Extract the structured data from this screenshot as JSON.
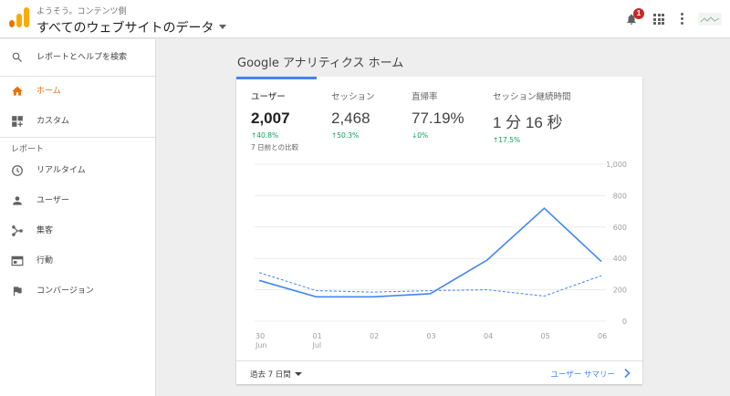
{
  "header": {
    "account": "ようそう。コンテンツ側",
    "property": "すべてのウェブサイトのデータ",
    "notification_count": "1"
  },
  "sidebar": {
    "search_label": "レポートとヘルプを検索",
    "home_label": "ホーム",
    "custom_label": "カスタム",
    "reports_section": "レポート",
    "items": [
      {
        "label": "リアルタイム",
        "icon": "clock-icon"
      },
      {
        "label": "ユーザー",
        "icon": "person-icon"
      },
      {
        "label": "集客",
        "icon": "acquisition-icon"
      },
      {
        "label": "行動",
        "icon": "behavior-icon"
      },
      {
        "label": "コンバージョン",
        "icon": "flag-icon"
      }
    ]
  },
  "main": {
    "title": "Google アナリティクス ホーム",
    "metrics": [
      {
        "name": "ユーザー",
        "value": "2,007",
        "delta": "↑40.8%",
        "compare": "7 日前との比較"
      },
      {
        "name": "セッション",
        "value": "2,468",
        "delta": "↑50.3%"
      },
      {
        "name": "直帰率",
        "value": "77.19%",
        "delta": "↓0%"
      },
      {
        "name": "セッション継続時間",
        "value": "1 分 16 秒",
        "delta": "↑17.5%"
      }
    ],
    "date_range": "過去 7 日間",
    "report_link": "ユーザー サマリー"
  },
  "colors": {
    "accent": "#e8710a",
    "primary_line": "#4285f4",
    "positive": "#0f9d58"
  },
  "chart_data": {
    "type": "line",
    "x": [
      "30 Jun",
      "01 Jul",
      "02",
      "03",
      "04",
      "05",
      "06"
    ],
    "x_ticks": [
      {
        "top": "30",
        "bottom": "Jun"
      },
      {
        "top": "01",
        "bottom": "Jul"
      },
      {
        "top": "02",
        "bottom": ""
      },
      {
        "top": "03",
        "bottom": ""
      },
      {
        "top": "04",
        "bottom": ""
      },
      {
        "top": "05",
        "bottom": ""
      },
      {
        "top": "06",
        "bottom": ""
      }
    ],
    "series": [
      {
        "style": "solid",
        "values": [
          260,
          155,
          155,
          175,
          390,
          720,
          380
        ]
      },
      {
        "style": "dashed",
        "values": [
          310,
          195,
          185,
          195,
          200,
          160,
          290
        ]
      }
    ],
    "y_ticks": [
      0,
      200,
      400,
      600,
      800,
      1000
    ],
    "y_tick_labels": [
      "0",
      "200",
      "400",
      "600",
      "800",
      "1,000"
    ],
    "ylim": [
      0,
      1000
    ],
    "grid": true
  }
}
